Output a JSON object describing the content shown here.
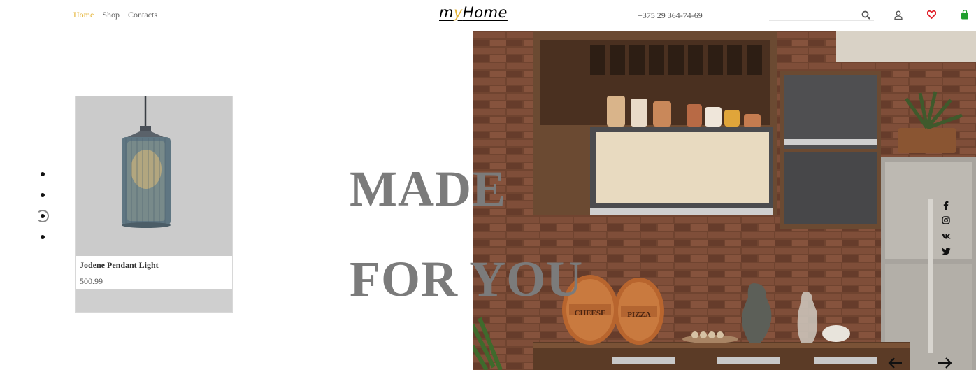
{
  "header": {
    "nav": [
      {
        "label": "Home",
        "active": true
      },
      {
        "label": "Shop",
        "active": false
      },
      {
        "label": "Contacts",
        "active": false
      }
    ],
    "logo": {
      "part1": "m",
      "part2": "y",
      "part3": "Home"
    },
    "phone": "+375 29 364-74-69",
    "search": {
      "value": "",
      "placeholder": ""
    },
    "icons": [
      "search-icon",
      "user-icon",
      "heart-icon",
      "bag-icon"
    ]
  },
  "slider": {
    "dots": 4,
    "active_index": 2
  },
  "product": {
    "name": "Jodene Pendant Light",
    "price": "500.99"
  },
  "hero": {
    "line1": "MADE",
    "line2": "FOR YOU"
  },
  "kitchen_image": {
    "labels": {
      "board1": "CHEESE",
      "board2": "PIZZA"
    }
  },
  "social": [
    "facebook-icon",
    "instagram-icon",
    "vk-icon",
    "twitter-icon"
  ],
  "colors": {
    "accent": "#e5b53a",
    "heart": "#e0202a",
    "bag": "#1f9e2d",
    "hero_text": "#7b7b7b"
  }
}
